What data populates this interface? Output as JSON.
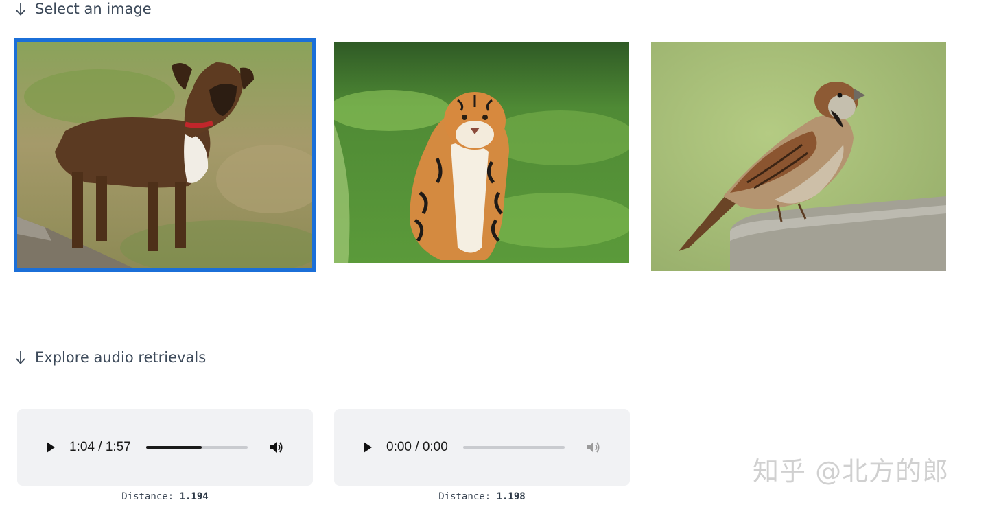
{
  "sections": {
    "select_image": {
      "title": "Select an image",
      "icon": "arrow-down-icon"
    },
    "audio_retrievals": {
      "title": "Explore audio retrievals",
      "icon": "arrow-down-icon"
    }
  },
  "images": [
    {
      "subject": "dog",
      "selected": true
    },
    {
      "subject": "tiger",
      "selected": false
    },
    {
      "subject": "sparrow",
      "selected": false
    }
  ],
  "audio_results": [
    {
      "time": "1:04 / 1:57",
      "progress": 0.547,
      "distance_label": "Distance:",
      "distance_value": "1.194",
      "volume_enabled": true
    },
    {
      "time": "0:00 / 0:00",
      "progress": 0,
      "distance_label": "Distance:",
      "distance_value": "1.198",
      "volume_enabled": false
    }
  ],
  "colors": {
    "selection_border": "#1b6fd8",
    "audio_card_bg": "#f1f2f4"
  },
  "watermark": "知乎 @北方的郎"
}
